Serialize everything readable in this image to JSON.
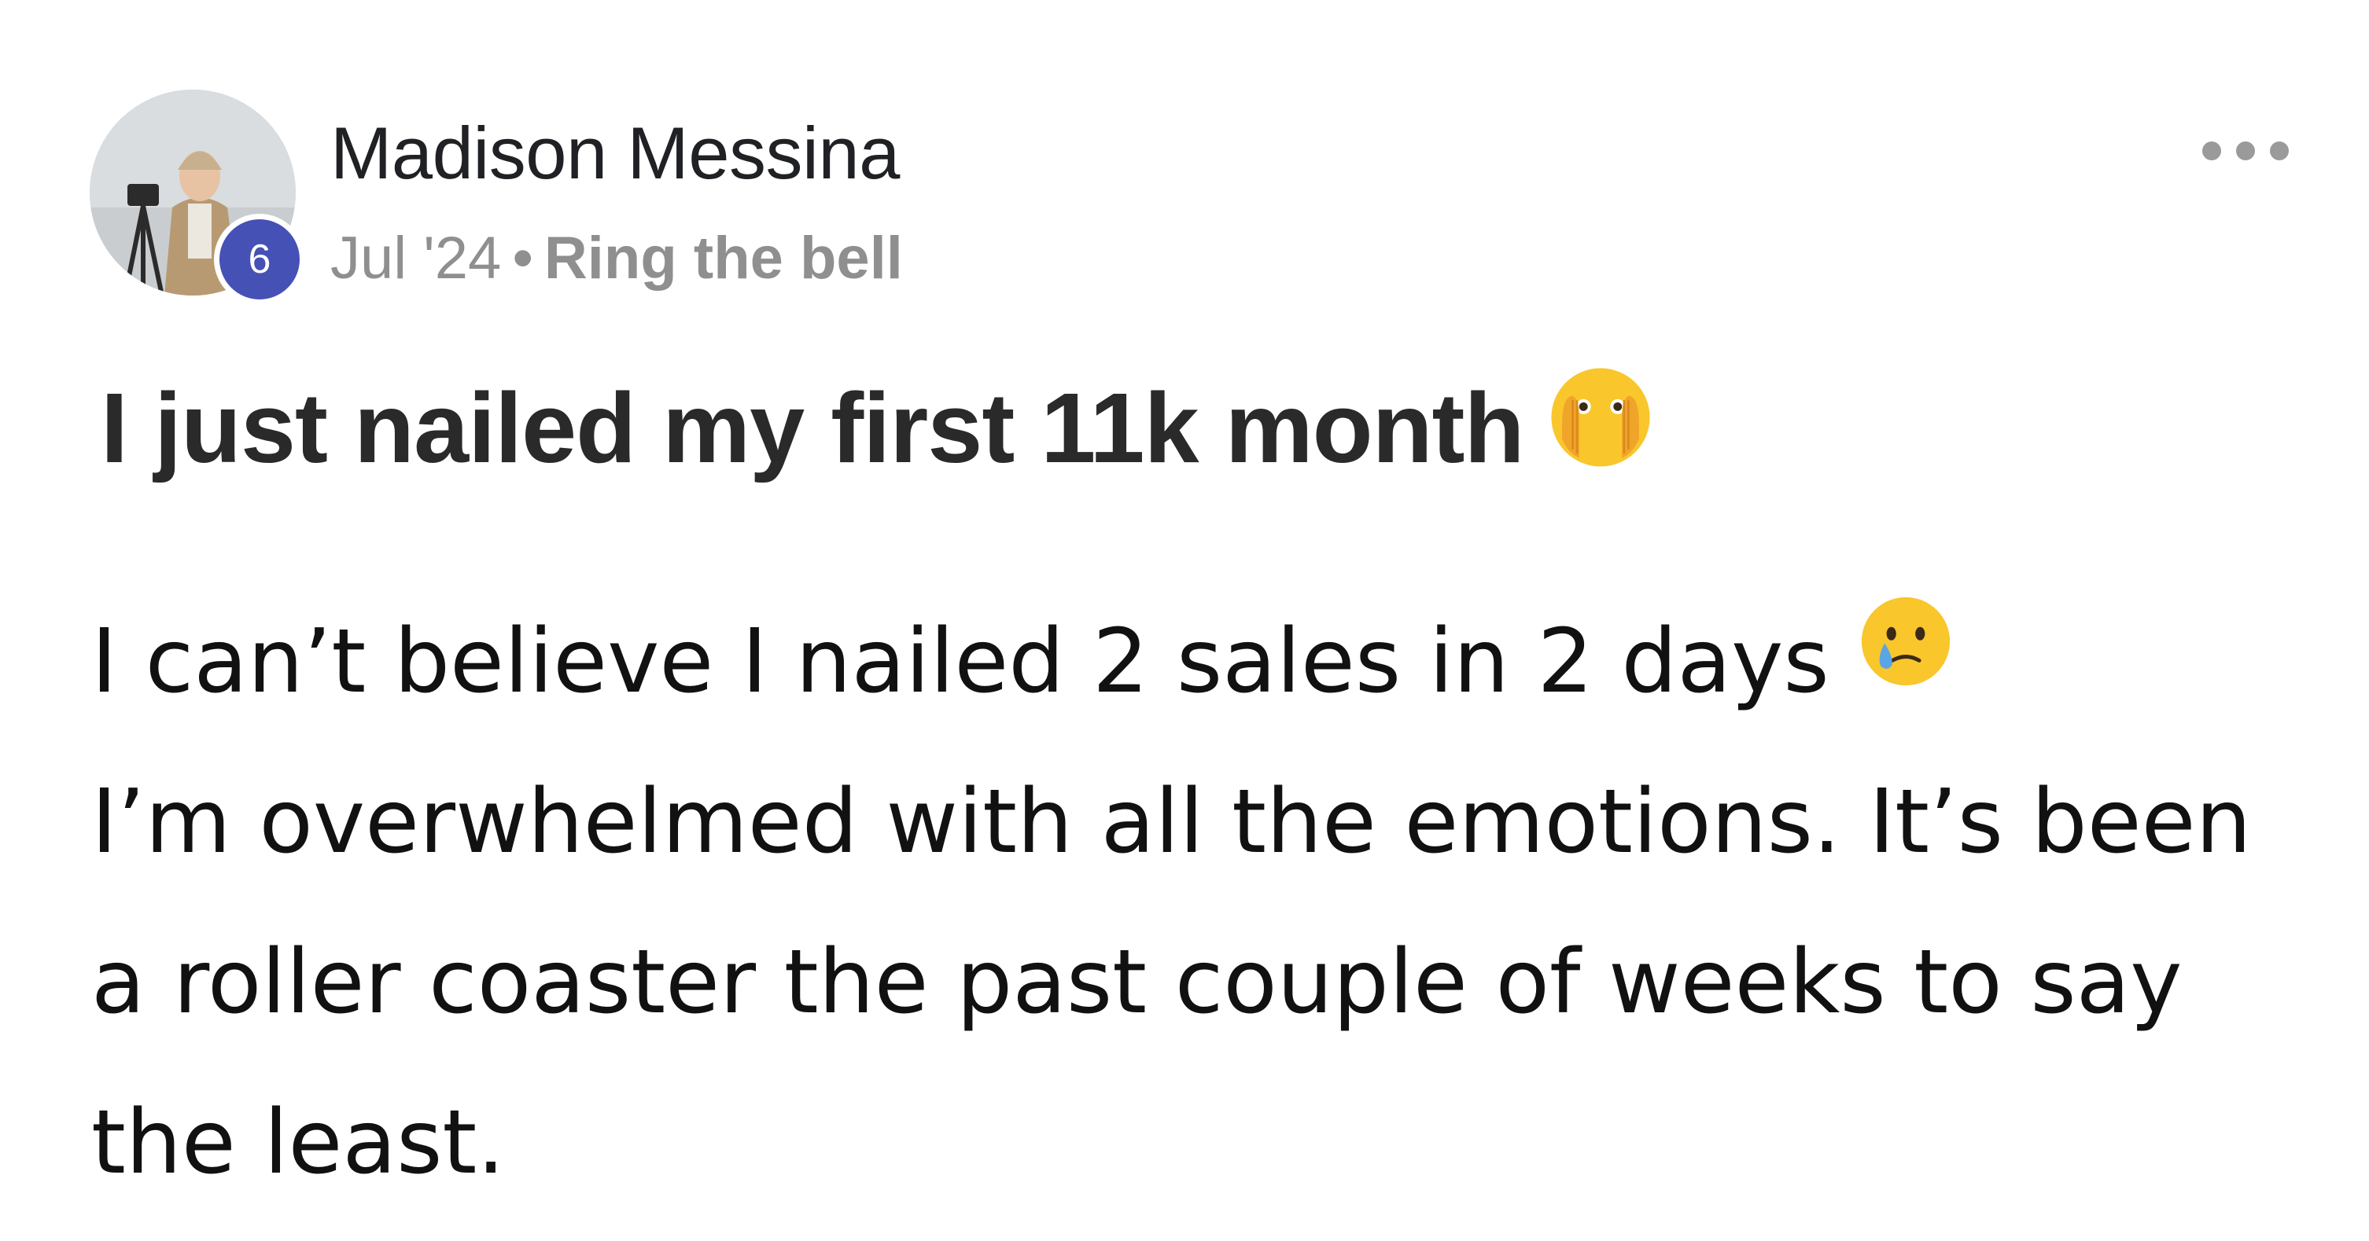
{
  "author": {
    "name": "Madison Messina",
    "level": "6"
  },
  "meta": {
    "date": "Jul '24",
    "separator": "•",
    "category": "Ring the bell"
  },
  "menu": {
    "icon": "more-horizontal-icon"
  },
  "post": {
    "title": "I just nailed my first 11k month",
    "title_emoji": "face-with-open-eyes-and-hand-over-mouth-icon",
    "body": [
      "I can’t believe I nailed 2 sales in 2 days",
      "I’m overwhelmed with all the emotions. It’s been a roller coaster the past couple of weeks to say the least."
    ],
    "body_emoji": "face-holding-back-tears-icon"
  },
  "colors": {
    "badge": "#4551b5",
    "meta_text": "#8f8f8f",
    "emoji_yellow": "#f9c62b",
    "tear_blue": "#5aa5e6"
  }
}
